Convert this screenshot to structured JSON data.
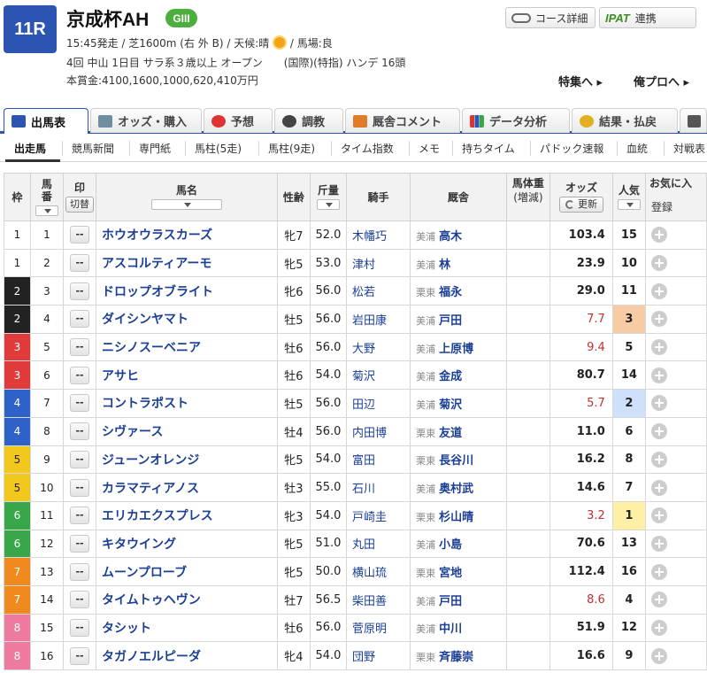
{
  "race": {
    "number": "11R",
    "name": "京成杯AH",
    "grade": "GIII",
    "line1_prefix": "15:45発走 / 芝1600m (右 外 B) / 天候:晴",
    "line1_suffix": "/ 馬場:良",
    "line2": "4回 中山 1日目 サラ系３歳以上 オープン　　(国際)(特指) ハンデ 16頭",
    "line3": "本賞金:4100,1600,1000,620,410万円"
  },
  "header_buttons": {
    "course": "コース詳細",
    "ipat_logo": "IPAT",
    "ipat_label": "連携"
  },
  "feature_links": {
    "special": "特集へ ▸",
    "blog": "俺プロへ ▸"
  },
  "colors": {
    "accent": "#2b55b0",
    "grade": "#4cae3c",
    "waku": [
      "#ffffff",
      "#222222",
      "#e03a3a",
      "#2f62c8",
      "#f2c81f",
      "#3aa64a",
      "#f08a1f",
      "#ef7aa0"
    ]
  },
  "tabs": [
    {
      "label": "出馬表",
      "icon": "table-icon"
    },
    {
      "label": "オッズ・購入",
      "icon": "odds-icon"
    },
    {
      "label": "予想",
      "icon": "target-icon"
    },
    {
      "label": "調教",
      "icon": "stopwatch-icon"
    },
    {
      "label": "厩舎コメント",
      "icon": "stable-icon"
    },
    {
      "label": "データ分析",
      "icon": "chart-icon"
    },
    {
      "label": "結果・払戻",
      "icon": "coins-icon"
    },
    {
      "label": "",
      "icon": "video-icon"
    }
  ],
  "subnav": [
    "出走馬",
    "競馬新聞",
    "専門紙",
    "馬柱(5走)",
    "馬柱(9走)",
    "タイム指数",
    "メモ",
    "持ちタイム",
    "パドック速報",
    "血統",
    "対戦表"
  ],
  "columns": {
    "waku": "枠",
    "umaban_1": "馬",
    "umaban_2": "番",
    "mark": "印",
    "mark_toggle": "切替",
    "name": "馬名",
    "sexage": "性齢",
    "weight": "斤量",
    "jockey": "騎手",
    "stable": "厩舎",
    "body_1": "馬体重",
    "body_2": "(増減)",
    "odds": "オッズ",
    "odds_refresh": "更新",
    "ninki": "人気",
    "fav_1": "お気に入",
    "fav_2": "登録"
  },
  "entries": [
    {
      "waku": 1,
      "umaban": 1,
      "mark": "--",
      "name": "ホウオウラスカーズ",
      "sexage": "牝7",
      "weight": "52.0",
      "jockey": "木幡巧",
      "belong": "美浦",
      "trainer": "高木",
      "odds": "103.4",
      "ninki": 15
    },
    {
      "waku": 1,
      "umaban": 2,
      "mark": "--",
      "name": "アスコルティアーモ",
      "sexage": "牝5",
      "weight": "53.0",
      "jockey": "津村",
      "belong": "美浦",
      "trainer": "林",
      "odds": "23.9",
      "ninki": 10
    },
    {
      "waku": 2,
      "umaban": 3,
      "mark": "--",
      "name": "ドロップオブライト",
      "sexage": "牝6",
      "weight": "56.0",
      "jockey": "松若",
      "belong": "栗東",
      "trainer": "福永",
      "odds": "29.0",
      "ninki": 11
    },
    {
      "waku": 2,
      "umaban": 4,
      "mark": "--",
      "name": "ダイシンヤマト",
      "sexage": "牡5",
      "weight": "56.0",
      "jockey": "岩田康",
      "belong": "美浦",
      "trainer": "戸田",
      "odds": "7.7",
      "ninki": 3
    },
    {
      "waku": 3,
      "umaban": 5,
      "mark": "--",
      "name": "ニシノスーベニア",
      "sexage": "牡6",
      "weight": "56.0",
      "jockey": "大野",
      "belong": "美浦",
      "trainer": "上原博",
      "odds": "9.4",
      "ninki": 5
    },
    {
      "waku": 3,
      "umaban": 6,
      "mark": "--",
      "name": "アサヒ",
      "sexage": "牡6",
      "weight": "54.0",
      "jockey": "菊沢",
      "belong": "美浦",
      "trainer": "金成",
      "odds": "80.7",
      "ninki": 14
    },
    {
      "waku": 4,
      "umaban": 7,
      "mark": "--",
      "name": "コントラポスト",
      "sexage": "牡5",
      "weight": "56.0",
      "jockey": "田辺",
      "belong": "美浦",
      "trainer": "菊沢",
      "odds": "5.7",
      "ninki": 2
    },
    {
      "waku": 4,
      "umaban": 8,
      "mark": "--",
      "name": "シヴァース",
      "sexage": "牡4",
      "weight": "56.0",
      "jockey": "内田博",
      "belong": "栗東",
      "trainer": "友道",
      "odds": "11.0",
      "ninki": 6
    },
    {
      "waku": 5,
      "umaban": 9,
      "mark": "--",
      "name": "ジューンオレンジ",
      "sexage": "牝5",
      "weight": "54.0",
      "jockey": "富田",
      "belong": "栗東",
      "trainer": "長谷川",
      "odds": "16.2",
      "ninki": 8
    },
    {
      "waku": 5,
      "umaban": 10,
      "mark": "--",
      "name": "カラマティアノス",
      "sexage": "牡3",
      "weight": "55.0",
      "jockey": "石川",
      "belong": "美浦",
      "trainer": "奥村武",
      "odds": "14.6",
      "ninki": 7
    },
    {
      "waku": 6,
      "umaban": 11,
      "mark": "--",
      "name": "エリカエクスプレス",
      "sexage": "牝3",
      "weight": "54.0",
      "jockey": "戸崎圭",
      "belong": "栗東",
      "trainer": "杉山晴",
      "odds": "3.2",
      "ninki": 1
    },
    {
      "waku": 6,
      "umaban": 12,
      "mark": "--",
      "name": "キタウイング",
      "sexage": "牝5",
      "weight": "51.0",
      "jockey": "丸田",
      "belong": "美浦",
      "trainer": "小島",
      "odds": "70.6",
      "ninki": 13
    },
    {
      "waku": 7,
      "umaban": 13,
      "mark": "--",
      "name": "ムーンプローブ",
      "sexage": "牝5",
      "weight": "50.0",
      "jockey": "横山琉",
      "belong": "栗東",
      "trainer": "宮地",
      "odds": "112.4",
      "ninki": 16
    },
    {
      "waku": 7,
      "umaban": 14,
      "mark": "--",
      "name": "タイムトゥヘヴン",
      "sexage": "牡7",
      "weight": "56.5",
      "jockey": "柴田善",
      "belong": "美浦",
      "trainer": "戸田",
      "odds": "8.6",
      "ninki": 4
    },
    {
      "waku": 8,
      "umaban": 15,
      "mark": "--",
      "name": "タシット",
      "sexage": "牡6",
      "weight": "56.0",
      "jockey": "菅原明",
      "belong": "美浦",
      "trainer": "中川",
      "odds": "51.9",
      "ninki": 12
    },
    {
      "waku": 8,
      "umaban": 16,
      "mark": "--",
      "name": "タガノエルピーダ",
      "sexage": "牝4",
      "weight": "54.0",
      "jockey": "団野",
      "belong": "栗東",
      "trainer": "斉藤崇",
      "odds": "16.6",
      "ninki": 9
    }
  ]
}
